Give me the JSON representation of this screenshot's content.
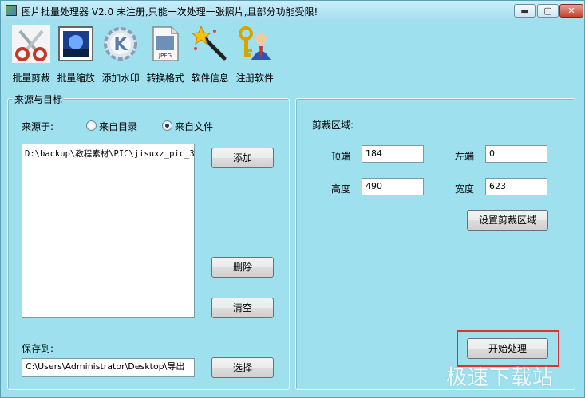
{
  "window": {
    "title": "图片批量处理器 V2.0   未注册,只能一次处理一张照片,且部分功能受限!",
    "min_label": "▬",
    "max_label": "▢",
    "close_label": "✕"
  },
  "toolbar": {
    "items": [
      {
        "label": "批量剪裁",
        "icon": "scissors-icon"
      },
      {
        "label": "批量缩放",
        "icon": "picture-icon"
      },
      {
        "label": "添加水印",
        "icon": "kde-gear-icon"
      },
      {
        "label": "转换格式",
        "icon": "jpeg-file-icon"
      },
      {
        "label": "软件信息",
        "icon": "magic-wand-icon"
      },
      {
        "label": "注册软件",
        "icon": "user-key-icon"
      }
    ]
  },
  "source": {
    "group_title": "来源与目标",
    "from_label": "来源于:",
    "radio_dir": "来自目录",
    "radio_file": "来自文件",
    "selected": "来自文件",
    "files": [
      "D:\\backup\\教程素材\\PIC\\jisuxz_pic_3"
    ],
    "add_button": "添加",
    "delete_button": "删除",
    "clear_button": "清空",
    "save_label": "保存到:",
    "save_path": "C:\\Users\\Administrator\\Desktop\\导出",
    "choose_button": "选择"
  },
  "crop": {
    "title": "剪裁区域:",
    "top_label": "顶端",
    "top_value": "184",
    "left_label": "左端",
    "left_value": "0",
    "height_label": "高度",
    "height_value": "490",
    "width_label": "宽度",
    "width_value": "623",
    "set_button": "设置剪裁区域",
    "start_button": "开始处理"
  },
  "watermark": "极速下载站",
  "colors": {
    "window_bg": "#9ee0ee",
    "highlight": "#e03030"
  }
}
